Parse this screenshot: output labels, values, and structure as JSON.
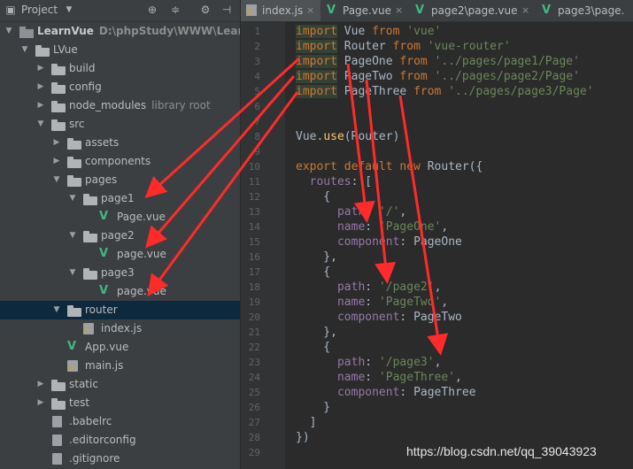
{
  "project_panel": {
    "title": "Project",
    "tree": [
      {
        "label": "LearnVue",
        "hint": "D:\\phpStudy\\WWW\\LearnVue",
        "type": "proj",
        "depth": 0,
        "expanded": true,
        "bold": true
      },
      {
        "label": "LVue",
        "type": "folder",
        "depth": 1,
        "expanded": true
      },
      {
        "label": "build",
        "type": "folder",
        "depth": 2,
        "expanded": false
      },
      {
        "label": "config",
        "type": "folder",
        "depth": 2,
        "expanded": false
      },
      {
        "label": "node_modules",
        "hint": "library root",
        "type": "folder",
        "depth": 2,
        "expanded": false
      },
      {
        "label": "src",
        "type": "folder",
        "depth": 2,
        "expanded": true
      },
      {
        "label": "assets",
        "type": "folder",
        "depth": 3,
        "expanded": false
      },
      {
        "label": "components",
        "type": "folder",
        "depth": 3,
        "expanded": false
      },
      {
        "label": "pages",
        "type": "folder",
        "depth": 3,
        "expanded": true
      },
      {
        "label": "page1",
        "type": "folder",
        "depth": 4,
        "expanded": true
      },
      {
        "label": "Page.vue",
        "type": "vue",
        "depth": 5
      },
      {
        "label": "page2",
        "type": "folder",
        "depth": 4,
        "expanded": true
      },
      {
        "label": "page.vue",
        "type": "vue",
        "depth": 5
      },
      {
        "label": "page3",
        "type": "folder",
        "depth": 4,
        "expanded": true
      },
      {
        "label": "page.vue",
        "type": "vue",
        "depth": 5
      },
      {
        "label": "router",
        "type": "folder",
        "depth": 3,
        "expanded": true,
        "selected": true
      },
      {
        "label": "index.js",
        "type": "js",
        "depth": 4
      },
      {
        "label": "App.vue",
        "type": "vue",
        "depth": 3
      },
      {
        "label": "main.js",
        "type": "js",
        "depth": 3
      },
      {
        "label": "static",
        "type": "folder",
        "depth": 2,
        "expanded": false
      },
      {
        "label": "test",
        "type": "folder",
        "depth": 2,
        "expanded": false
      },
      {
        "label": ".babelrc",
        "type": "cfg",
        "depth": 2
      },
      {
        "label": ".editorconfig",
        "type": "cfg",
        "depth": 2
      },
      {
        "label": ".gitignore",
        "type": "cfg",
        "depth": 2
      }
    ]
  },
  "tabs": [
    {
      "label": "index.js",
      "icon": "js",
      "active": true
    },
    {
      "label": "Page.vue",
      "icon": "vue"
    },
    {
      "label": "page2\\page.vue",
      "icon": "vue"
    },
    {
      "label": "page3\\page.",
      "icon": "vue"
    }
  ],
  "code_lines": [
    {
      "n": "1",
      "parts": [
        [
          "kw",
          "import"
        ],
        [
          "t",
          " Vue "
        ],
        [
          "kw",
          "from"
        ],
        [
          "t",
          " "
        ],
        [
          "str",
          "'vue'"
        ]
      ]
    },
    {
      "n": "2",
      "parts": [
        [
          "kw",
          "import"
        ],
        [
          "t",
          " Router "
        ],
        [
          "kw",
          "from"
        ],
        [
          "t",
          " "
        ],
        [
          "str",
          "'vue-router'"
        ]
      ]
    },
    {
      "n": "3",
      "parts": [
        [
          "kw",
          "import"
        ],
        [
          "t",
          " PageOne "
        ],
        [
          "kw",
          "from"
        ],
        [
          "t",
          " "
        ],
        [
          "str",
          "'../pages/page1/Page'"
        ]
      ]
    },
    {
      "n": "4",
      "parts": [
        [
          "kw",
          "import"
        ],
        [
          "t",
          " PageTwo "
        ],
        [
          "kw",
          "from"
        ],
        [
          "t",
          " "
        ],
        [
          "str",
          "'../pages/page2/Page'"
        ]
      ]
    },
    {
      "n": "5",
      "parts": [
        [
          "kw",
          "import"
        ],
        [
          "t",
          " PageThree "
        ],
        [
          "kw",
          "from"
        ],
        [
          "t",
          " "
        ],
        [
          "str",
          "'../pages/page3/Page'"
        ]
      ]
    },
    {
      "n": "6",
      "parts": []
    },
    {
      "n": "7",
      "parts": []
    },
    {
      "n": "8",
      "parts": [
        [
          "t",
          "Vue."
        ],
        [
          "fn",
          "use"
        ],
        [
          "t",
          "(Router)"
        ]
      ]
    },
    {
      "n": "9",
      "parts": []
    },
    {
      "n": "10",
      "parts": [
        [
          "kw",
          "export default new"
        ],
        [
          "t",
          " Router({"
        ]
      ]
    },
    {
      "n": "11",
      "parts": [
        [
          "t",
          "  "
        ],
        [
          "prop",
          "routes"
        ],
        [
          "t",
          ": ["
        ]
      ]
    },
    {
      "n": "12",
      "parts": [
        [
          "t",
          "    {"
        ]
      ]
    },
    {
      "n": "13",
      "parts": [
        [
          "t",
          "      "
        ],
        [
          "prop",
          "path"
        ],
        [
          "t",
          ": "
        ],
        [
          "str",
          "'/'"
        ],
        [
          "t",
          ","
        ]
      ]
    },
    {
      "n": "14",
      "parts": [
        [
          "t",
          "      "
        ],
        [
          "prop",
          "name"
        ],
        [
          "t",
          ": "
        ],
        [
          "str",
          "'PageOne'"
        ],
        [
          "t",
          ","
        ]
      ]
    },
    {
      "n": "15",
      "parts": [
        [
          "t",
          "      "
        ],
        [
          "prop",
          "component"
        ],
        [
          "t",
          ": PageOne"
        ]
      ]
    },
    {
      "n": "16",
      "parts": [
        [
          "t",
          "    },"
        ]
      ]
    },
    {
      "n": "17",
      "parts": [
        [
          "t",
          "    {"
        ]
      ]
    },
    {
      "n": "18",
      "parts": [
        [
          "t",
          "      "
        ],
        [
          "prop",
          "path"
        ],
        [
          "t",
          ": "
        ],
        [
          "str",
          "'/page2'"
        ],
        [
          "t",
          ","
        ]
      ]
    },
    {
      "n": "19",
      "parts": [
        [
          "t",
          "      "
        ],
        [
          "prop",
          "name"
        ],
        [
          "t",
          ": "
        ],
        [
          "str",
          "'PageTwo'"
        ],
        [
          "t",
          ","
        ]
      ]
    },
    {
      "n": "20",
      "parts": [
        [
          "t",
          "      "
        ],
        [
          "prop",
          "component"
        ],
        [
          "t",
          ": PageTwo"
        ]
      ]
    },
    {
      "n": "21",
      "parts": [
        [
          "t",
          "    },"
        ]
      ]
    },
    {
      "n": "22",
      "parts": [
        [
          "t",
          "    {"
        ]
      ]
    },
    {
      "n": "23",
      "parts": [
        [
          "t",
          "      "
        ],
        [
          "prop",
          "path"
        ],
        [
          "t",
          ": "
        ],
        [
          "str",
          "'/page3'"
        ],
        [
          "t",
          ","
        ]
      ]
    },
    {
      "n": "24",
      "parts": [
        [
          "t",
          "      "
        ],
        [
          "prop",
          "name"
        ],
        [
          "t",
          ": "
        ],
        [
          "str",
          "'PageThree'"
        ],
        [
          "t",
          ","
        ]
      ]
    },
    {
      "n": "25",
      "parts": [
        [
          "t",
          "      "
        ],
        [
          "prop",
          "component"
        ],
        [
          "t",
          ": PageThree"
        ]
      ]
    },
    {
      "n": "26",
      "parts": [
        [
          "t",
          "    }"
        ]
      ]
    },
    {
      "n": "27",
      "parts": [
        [
          "t",
          "  ]"
        ]
      ]
    },
    {
      "n": "28",
      "parts": [
        [
          "t",
          "})"
        ]
      ]
    },
    {
      "n": "29",
      "parts": []
    }
  ],
  "watermark": "https://blog.csdn.net/qq_39043923",
  "colors": {
    "arrow": "#ff2b2b",
    "selection": "#0d293e",
    "vue": "#41b883"
  }
}
